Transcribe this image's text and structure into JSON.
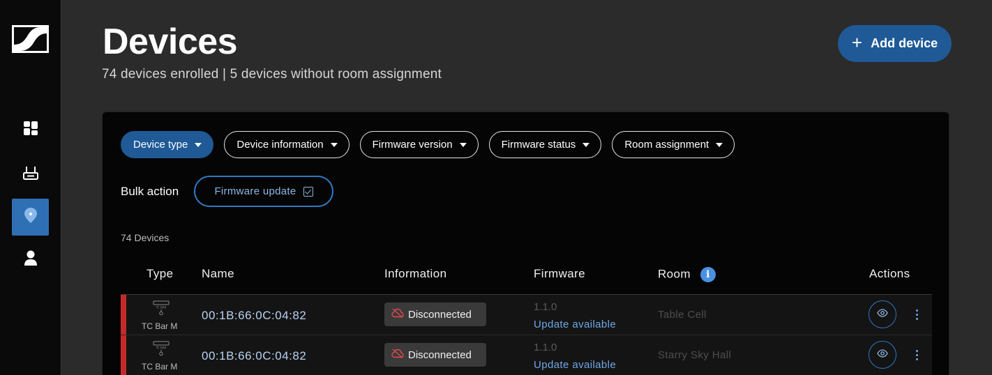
{
  "sidebar": {
    "logo_icon": "sennheiser-logo",
    "items": [
      {
        "icon": "dashboard-icon",
        "active": false
      },
      {
        "icon": "router-icon",
        "active": false
      },
      {
        "icon": "location-pin-icon",
        "active": true
      },
      {
        "icon": "user-icon",
        "active": false
      }
    ]
  },
  "header": {
    "title": "Devices",
    "subtitle": "74 devices enrolled | 5 devices without room assignment",
    "add_label": "Add device",
    "add_icon": "plus-icon"
  },
  "filters": [
    {
      "label": "Device type",
      "active": true
    },
    {
      "label": "Device information",
      "active": false
    },
    {
      "label": "Firmware version",
      "active": false
    },
    {
      "label": "Firmware status",
      "active": false
    },
    {
      "label": "Room assignment",
      "active": false
    }
  ],
  "bulk": {
    "label": "Bulk action",
    "button_label": "Firmware update"
  },
  "table": {
    "count_label": "74 Devices",
    "columns": {
      "type": "Type",
      "name": "Name",
      "information": "Information",
      "firmware": "Firmware",
      "room": "Room",
      "actions": "Actions"
    },
    "rows": [
      {
        "type": "TC Bar M",
        "name": "00:1B:66:0C:04:82",
        "status": "Disconnected",
        "firmware_version": "1.1.0",
        "firmware_status": "Update available",
        "room": "Table Cell"
      },
      {
        "type": "TC Bar M",
        "name": "00:1B:66:0C:04:82",
        "status": "Disconnected",
        "firmware_version": "1.1.0",
        "firmware_status": "Update available",
        "room": "Starry Sky Hall"
      }
    ]
  },
  "colors": {
    "accent": "#1f5a97",
    "link": "#6fa7e6",
    "error": "#c52a2a",
    "sidebar_bg": "#0a0a0a",
    "page_bg": "#2b2b2b"
  }
}
